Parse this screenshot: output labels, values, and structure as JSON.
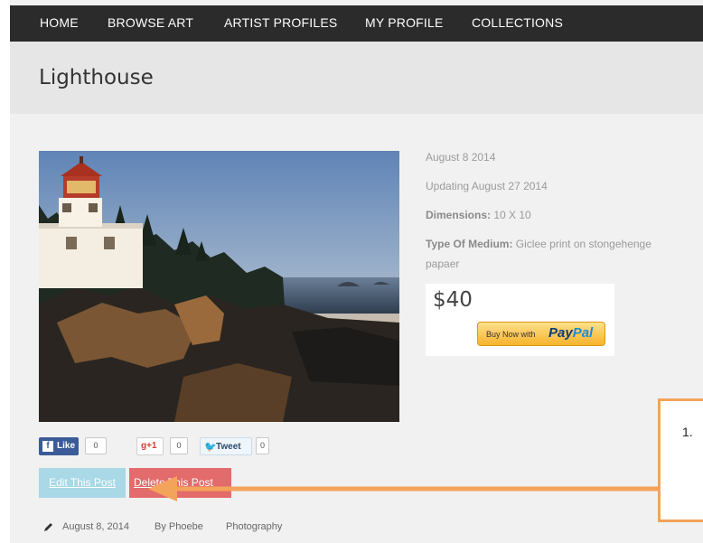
{
  "nav": {
    "items": [
      "HOME",
      "BROWSE ART",
      "ARTIST PROFILES",
      "MY PROFILE",
      "COLLECTIONS"
    ]
  },
  "page": {
    "title": "Lighthouse"
  },
  "artwork": {
    "posted_date": "August 8 2014",
    "updated": "Updating August 27 2014",
    "dimensions_label": "Dimensions:",
    "dimensions_value": "10 X 10",
    "medium_label": "Type Of Medium:",
    "medium_value": "Giclee print on stongehenge",
    "medium_value_cont": "papaer",
    "price": "$40",
    "buy_label": "Buy Now with",
    "paypal_pay": "Pay",
    "paypal_pal": "Pal"
  },
  "share": {
    "like_icon": "f",
    "like_label": "Like",
    "like_count": "0",
    "gplus_label": "g+1",
    "gplus_count": "0",
    "tweet_label": "Tweet",
    "tweet_count": "0"
  },
  "actions": {
    "edit_label": "Edit This Post",
    "delete_label": "Delete This Post"
  },
  "post_meta": {
    "date": "August 8, 2014",
    "author": "By Phoebe",
    "category": "Photography"
  },
  "callout": {
    "number": "1."
  },
  "icons": {
    "pencil": "pencil-icon",
    "facebook": "facebook-icon",
    "googleplus": "google-plus-icon",
    "twitter": "twitter-bird-icon",
    "arrow": "annotation-arrow-icon"
  },
  "colors": {
    "nav_bg": "#2b2b2b",
    "edit_bg": "#a9d8e6",
    "delete_bg": "#e36b6b",
    "callout_border": "#f4a35b",
    "paypal_gradient": "#f7b32d"
  }
}
